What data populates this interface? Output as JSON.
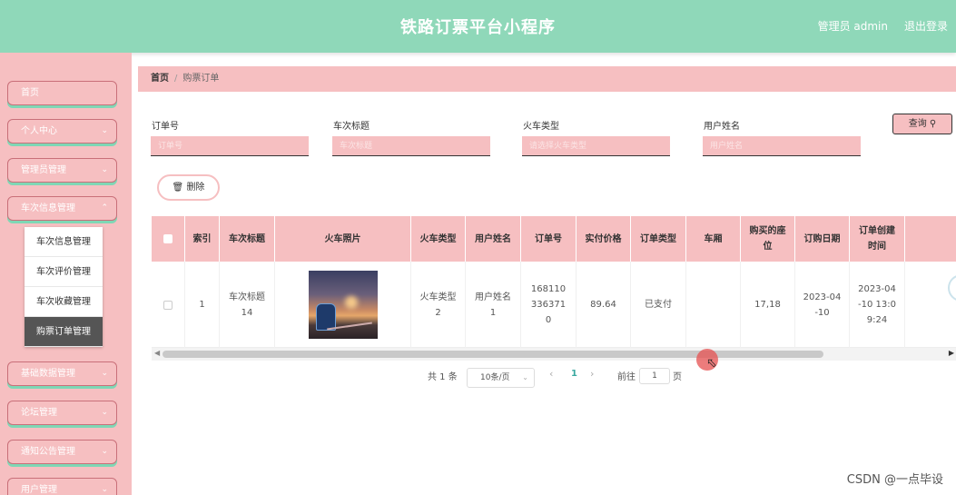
{
  "header": {
    "title": "铁路订票平台小程序",
    "user": "管理员 admin",
    "logout": "退出登录"
  },
  "sidebar": {
    "items": [
      {
        "label": "首页"
      },
      {
        "label": "个人中心"
      },
      {
        "label": "管理员管理"
      },
      {
        "label": "车次信息管理"
      },
      {
        "label": "基础数据管理"
      },
      {
        "label": "论坛管理"
      },
      {
        "label": "通知公告管理"
      },
      {
        "label": "用户管理"
      }
    ],
    "submenu": [
      {
        "label": "车次信息管理"
      },
      {
        "label": "车次评价管理"
      },
      {
        "label": "车次收藏管理"
      },
      {
        "label": "购票订单管理"
      }
    ]
  },
  "breadcrumb": {
    "home": "首页",
    "current": "购票订单"
  },
  "search": {
    "fields": [
      {
        "label": "订单号",
        "placeholder": "订单号"
      },
      {
        "label": "车次标题",
        "placeholder": "车次标题"
      },
      {
        "label": "火车类型",
        "placeholder": "请选择火车类型"
      },
      {
        "label": "用户姓名",
        "placeholder": "用户姓名"
      }
    ],
    "query_button": "查询",
    "query_icon": "search-icon"
  },
  "actions": {
    "delete_button": "删除",
    "delete_icon": "trash-icon"
  },
  "table": {
    "columns": [
      "索引",
      "车次标题",
      "火车照片",
      "火车类型",
      "用户姓名",
      "订单号",
      "实付价格",
      "订单类型",
      "车厢",
      "购买的座位",
      "订购日期",
      "订单创建时间"
    ],
    "rows": [
      {
        "index": "1",
        "train_title": "车次标题14",
        "train_type": "火车类型2",
        "user_name": "用户姓名1",
        "order_no": "1681103363710",
        "price": "89.64",
        "order_type": "已支付",
        "carriage": "",
        "seat": "17,18",
        "order_date": "2023-04-10",
        "created_time": "2023-04-10 13:09:24"
      }
    ]
  },
  "pagination": {
    "total": "共 1 条",
    "page_size": "10条/页",
    "current_page": "1",
    "goto_label": "前往",
    "goto_value": "1",
    "page_unit": "页"
  },
  "watermark": "CSDN @一点毕设",
  "colors": {
    "header_bg": "#8fd8b9",
    "sidebar_bg": "#f6bfc1",
    "menu_shadow": "#7fd7b5",
    "active_submenu": "#555555",
    "page_active": "#3aa8a0"
  }
}
